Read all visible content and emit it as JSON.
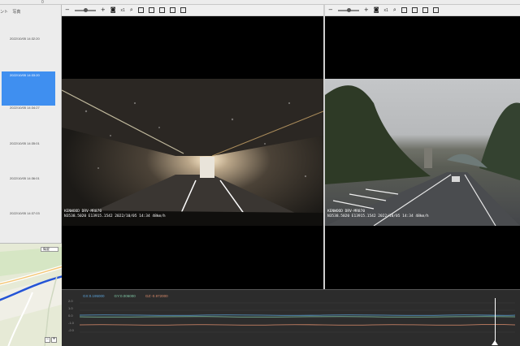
{
  "titlebar": {
    "marker": "0"
  },
  "sidebar": {
    "tabs": [
      "ント",
      "写真"
    ],
    "files": [
      {
        "time": "2022/10/05 14:32:20",
        "active": false
      },
      {
        "time": "2022/10/05 14:33:20",
        "active": true
      },
      {
        "time": "2022/10/05 14:34:27",
        "active": false
      },
      {
        "time": "2022/10/05 14:35:01",
        "active": false
      },
      {
        "time": "2022/10/05 14:36:01",
        "active": false
      },
      {
        "time": "2022/10/05 14:37:03",
        "active": false
      }
    ],
    "map": {
      "select_label": "衛星",
      "zoom_in": "+",
      "zoom_out": "−"
    }
  },
  "players": {
    "left": {
      "zoom_label": "x1",
      "overlay_line1": "KENWOOD DRV-MR870",
      "overlay_line2": "N3538.5020  E13915.1542  2022/10/05  14:34   48km/h"
    },
    "right": {
      "zoom_label": "x1",
      "overlay_line1": "KENWOOD DRV-MR870",
      "overlay_line2": "N3538.5020  E13915.1542  2022/10/05  14:34   48km/h"
    }
  },
  "graph": {
    "legend": [
      {
        "text": "GX:0.195000",
        "color": "#5aa0d6"
      },
      {
        "text": "GY:0.006000",
        "color": "#7fc6a4"
      },
      {
        "text": "GZ:-0.972000",
        "color": "#d88a6a"
      }
    ],
    "ticks": [
      "2.0",
      "1.0",
      "0.0",
      "-1.0",
      "-2.0"
    ]
  }
}
